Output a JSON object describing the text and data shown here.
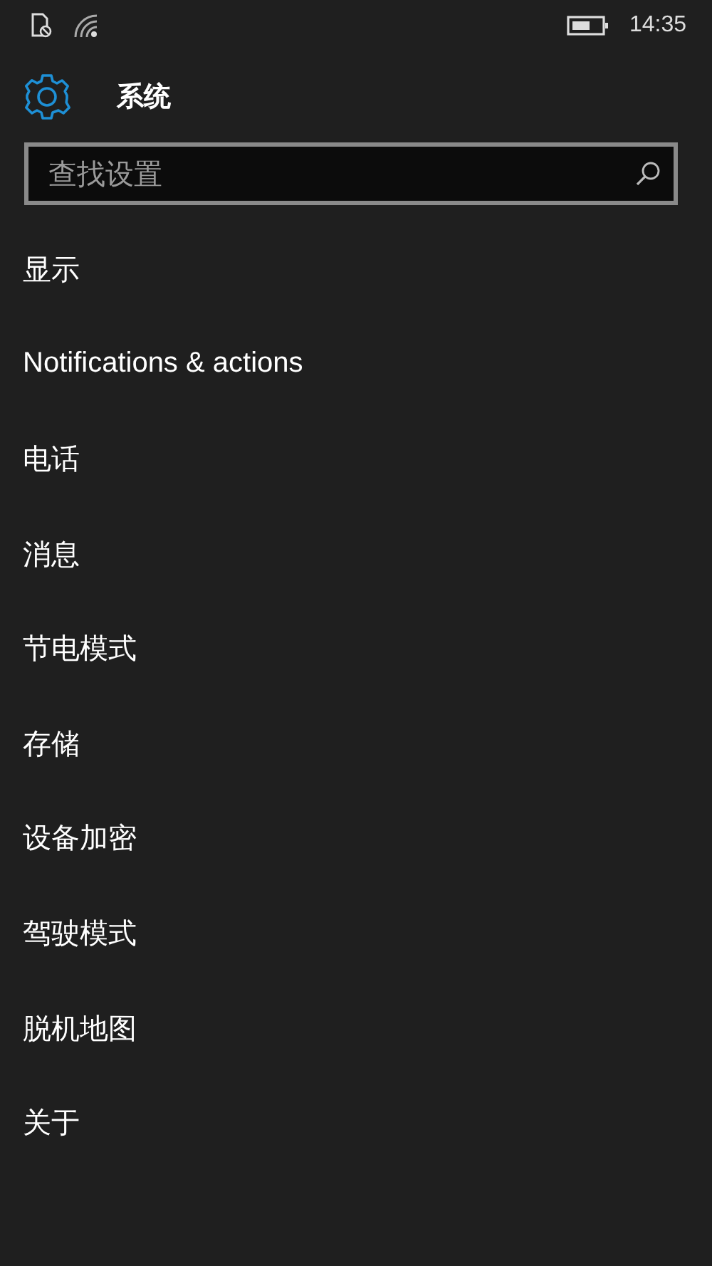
{
  "status_bar": {
    "time": "14:35"
  },
  "header": {
    "title": "系统"
  },
  "search": {
    "placeholder": "查找设置"
  },
  "items": [
    {
      "label": "显示"
    },
    {
      "label": "Notifications & actions"
    },
    {
      "label": "电话"
    },
    {
      "label": "消息"
    },
    {
      "label": "节电模式"
    },
    {
      "label": "存储"
    },
    {
      "label": "设备加密"
    },
    {
      "label": "驾驶模式"
    },
    {
      "label": "脱机地图"
    },
    {
      "label": "关于"
    }
  ]
}
